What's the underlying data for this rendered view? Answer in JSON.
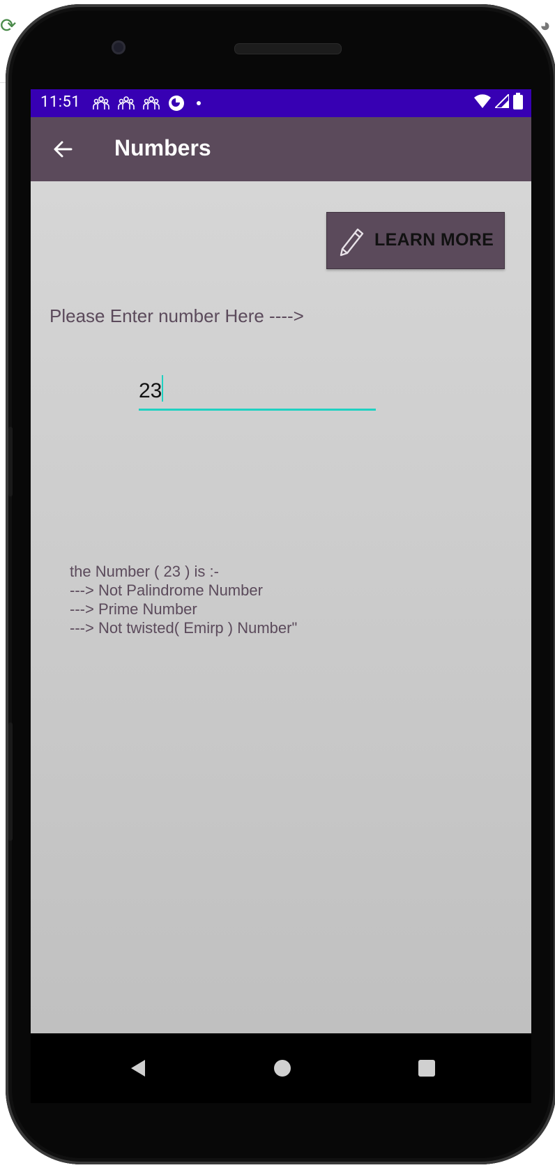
{
  "status_bar": {
    "time": "11:51",
    "notification_icons": [
      "group-icon",
      "group-icon",
      "group-icon",
      "app-circle-icon"
    ],
    "indicator_icons": [
      "wifi-icon",
      "signal-icon",
      "battery-icon"
    ]
  },
  "app_bar": {
    "title": "Numbers",
    "back_icon": "arrow-back-icon"
  },
  "main": {
    "learn_more_label": "LEARN MORE",
    "learn_more_icon": "pencil-icon",
    "prompt": "Please Enter number Here ---->",
    "input_value": "23",
    "result_lines": [
      "the Number ( 23 ) is :-",
      "---> Not Palindrome Number",
      "---> Prime Number",
      "---> Not twisted( Emirp ) Number\""
    ]
  },
  "nav_bar": {
    "icons": [
      "nav-back-icon",
      "nav-home-icon",
      "nav-recents-icon"
    ]
  },
  "colors": {
    "status_bar": "#3700b3",
    "app_bar": "#5b4a5b",
    "input_underline": "#1fd1c1",
    "text": "#5b4a5b"
  }
}
